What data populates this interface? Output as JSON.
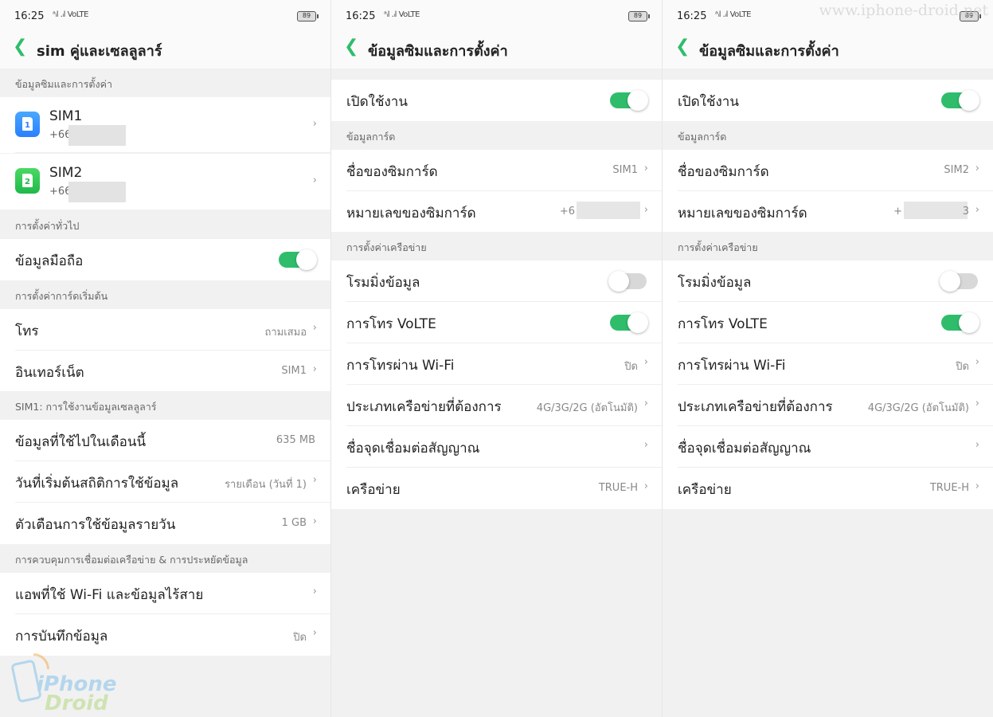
{
  "status": {
    "time": "16:25",
    "signal_text": "ᵃᵢl .ᵢl VoLTE",
    "battery": "89"
  },
  "watermark_url": "www.iphone-droid.net",
  "logo": {
    "line1": "iPhone",
    "line2": "Droid"
  },
  "colors": {
    "accent": "#2fbd6c",
    "sim1": "#2a7fff",
    "sim2": "#1fb94a"
  },
  "panel1": {
    "title": "sim คู่และเซลลูลาร์",
    "sec_sim_info": "ข้อมูลซิมและการตั้งค่า",
    "sims": [
      {
        "label": "SIM1",
        "number": "+66",
        "icon": "sim1-icon",
        "card_text": "1"
      },
      {
        "label": "SIM2",
        "number": "+66",
        "icon": "sim2-icon",
        "card_text": "2"
      }
    ],
    "sec_general": "การตั้งค่าทั่วไป",
    "mobile_data": "ข้อมูลมือถือ",
    "mobile_data_on": true,
    "sec_default": "การตั้งค่าการ์ดเริ่มต้น",
    "call_label": "โทร",
    "call_value": "ถามเสมอ",
    "internet_label": "อินเทอร์เน็ต",
    "internet_value": "SIM1",
    "sec_usage": "SIM1: การใช้งานข้อมูลเซลลูลาร์",
    "usage_label": "ข้อมูลที่ใช้ไปในเดือนนี้",
    "usage_value": "635 MB",
    "start_label": "วันที่เริ่มต้นสถิติการใช้ข้อมูล",
    "start_value": "รายเดือน (วันที่ 1)",
    "daily_label": "ตัวเตือนการใช้ข้อมูลรายวัน",
    "daily_value": "1 GB",
    "sec_control": "การควบคุมการเชื่อมต่อเครือข่าย & การประหยัดข้อมูล",
    "apps_label": "แอพที่ใช้ Wi-Fi และข้อมูลไร้สาย",
    "saver_label": "การบันทึกข้อมูล",
    "saver_value": "ปิด"
  },
  "panel2": {
    "title": "ข้อมูลซิมและการตั้งค่า",
    "enable_label": "เปิดใช้งาน",
    "enable_on": true,
    "sec_card": "ข้อมูลการ์ด",
    "name_label": "ชื่อของซิมการ์ด",
    "name_value": "SIM1",
    "number_label": "หมายเลขของซิมการ์ด",
    "number_value": "+6",
    "sec_network": "การตั้งค่าเครือข่าย",
    "roaming_label": "โรมมิ่งข้อมูล",
    "roaming_on": false,
    "volte_label": "การโทร VoLTE",
    "volte_on": true,
    "wifi_label": "การโทรผ่าน Wi-Fi",
    "wifi_value": "ปิด",
    "pref_label": "ประเภทเครือข่ายที่ต้องการ",
    "pref_value": "4G/3G/2G (อัตโนมัติ)",
    "apn_label": "ชื่อจุดเชื่อมต่อสัญญาณ",
    "carrier_label": "เครือข่าย",
    "carrier_value": "TRUE-H"
  },
  "panel3": {
    "title": "ข้อมูลซิมและการตั้งค่า",
    "enable_label": "เปิดใช้งาน",
    "enable_on": true,
    "sec_card": "ข้อมูลการ์ด",
    "name_label": "ชื่อของซิมการ์ด",
    "name_value": "SIM2",
    "number_label": "หมายเลขของซิมการ์ด",
    "number_value": "+",
    "number_suffix": "3",
    "sec_network": "การตั้งค่าเครือข่าย",
    "roaming_label": "โรมมิ่งข้อมูล",
    "roaming_on": false,
    "volte_label": "การโทร VoLTE",
    "volte_on": true,
    "wifi_label": "การโทรผ่าน Wi-Fi",
    "wifi_value": "ปิด",
    "pref_label": "ประเภทเครือข่ายที่ต้องการ",
    "pref_value": "4G/3G/2G (อัตโนมัติ)",
    "apn_label": "ชื่อจุดเชื่อมต่อสัญญาณ",
    "carrier_label": "เครือข่าย",
    "carrier_value": "TRUE-H"
  }
}
